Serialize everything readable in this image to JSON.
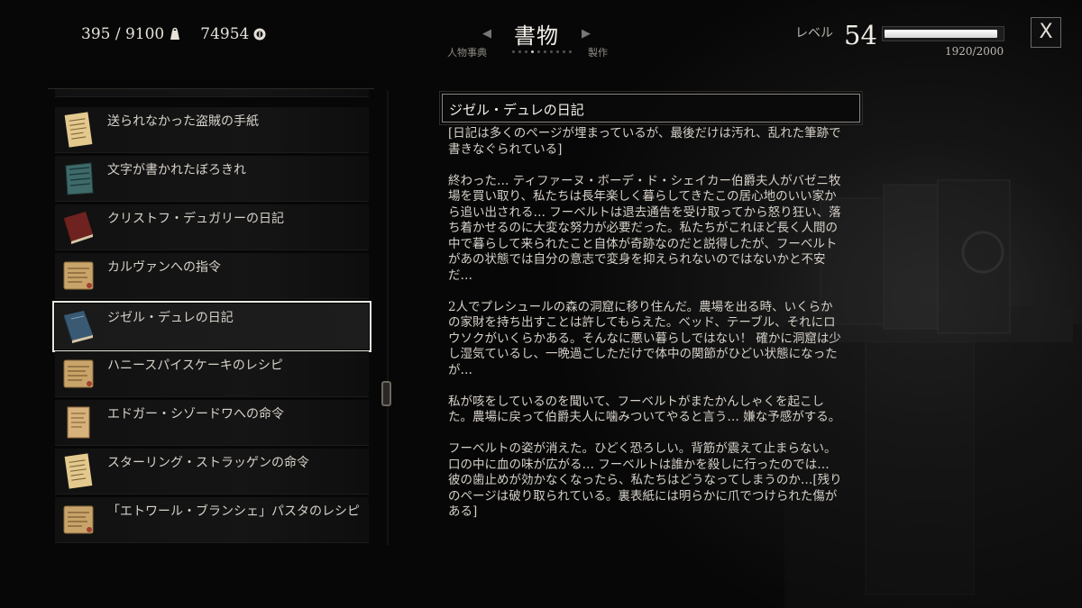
{
  "header": {
    "carry_weight": "395 / 9100",
    "money": "74954",
    "title": "書物",
    "prev_tab": "人物事典",
    "next_tab": "製作",
    "level_label": "レベル",
    "level": "54",
    "xp_text": "1920/2000",
    "xp_fraction": 0.96,
    "close_label": "X"
  },
  "books": [
    {
      "label": "",
      "icon": "scroll-icon"
    },
    {
      "label": "送られなかった盗賊の手紙",
      "icon": "letter-icon"
    },
    {
      "label": "文字が書かれたぼろきれ",
      "icon": "cloth-icon"
    },
    {
      "label": "クリストフ・デュガリーの日記",
      "icon": "book-red-icon"
    },
    {
      "label": "カルヴァンへの指令",
      "icon": "scroll-icon"
    },
    {
      "label": "ジゼル・デュレの日記",
      "icon": "book-blue-icon"
    },
    {
      "label": "ハニースパイスケーキのレシピ",
      "icon": "scroll-icon"
    },
    {
      "label": "エドガー・シゾードワへの命令",
      "icon": "parchment-icon"
    },
    {
      "label": "スターリング・ストラッゲンの命令",
      "icon": "letter-icon"
    },
    {
      "label": "「エトワール・ブランシェ」パスタのレシピ",
      "icon": "scroll-icon"
    }
  ],
  "selected_index": 5,
  "document": {
    "title": "ジゼル・デュレの日記",
    "paragraphs": [
      "[日記は多くのページが埋まっているが、最後だけは汚れ、乱れた筆跡で書きなぐられている]",
      "終わった… ティファーヌ・ボーデ・ド・シェイカー伯爵夫人がバゼニ牧場を買い取り、私たちは長年楽しく暮らしてきたこの居心地のいい家から追い出される… フーベルトは退去通告を受け取ってから怒り狂い、落ち着かせるのに大変な努力が必要だった。私たちがこれほど長く人間の中で暮らして来られたこと自体が奇跡なのだと説得したが、フーベルトがあの状態では自分の意志で変身を抑えられないのではないかと不安だ…",
      "2人でプレシュールの森の洞窟に移り住んだ。農場を出る時、いくらかの家財を持ち出すことは許してもらえた。ベッド、テーブル、それにロウソクがいくらかある。そんなに悪い暮らしではない！ 確かに洞窟は少し湿気ているし、一晩過ごしただけで体中の関節がひどい状態になったが…",
      "私が咳をしているのを聞いて、フーベルトがまたかんしゃくを起こした。農場に戻って伯爵夫人に噛みついてやると言う… 嫌な予感がする。",
      "フーベルトの姿が消えた。ひどく恐ろしい。背筋が震えて止まらない。口の中に血の味が広がる… フーベルトは誰かを殺しに行ったのでは… 彼の歯止めが効かなくなったら、私たちはどうなってしまうのか…[残りのページは破り取られている。裏表紙には明らかに爪でつけられた傷がある]"
    ]
  }
}
